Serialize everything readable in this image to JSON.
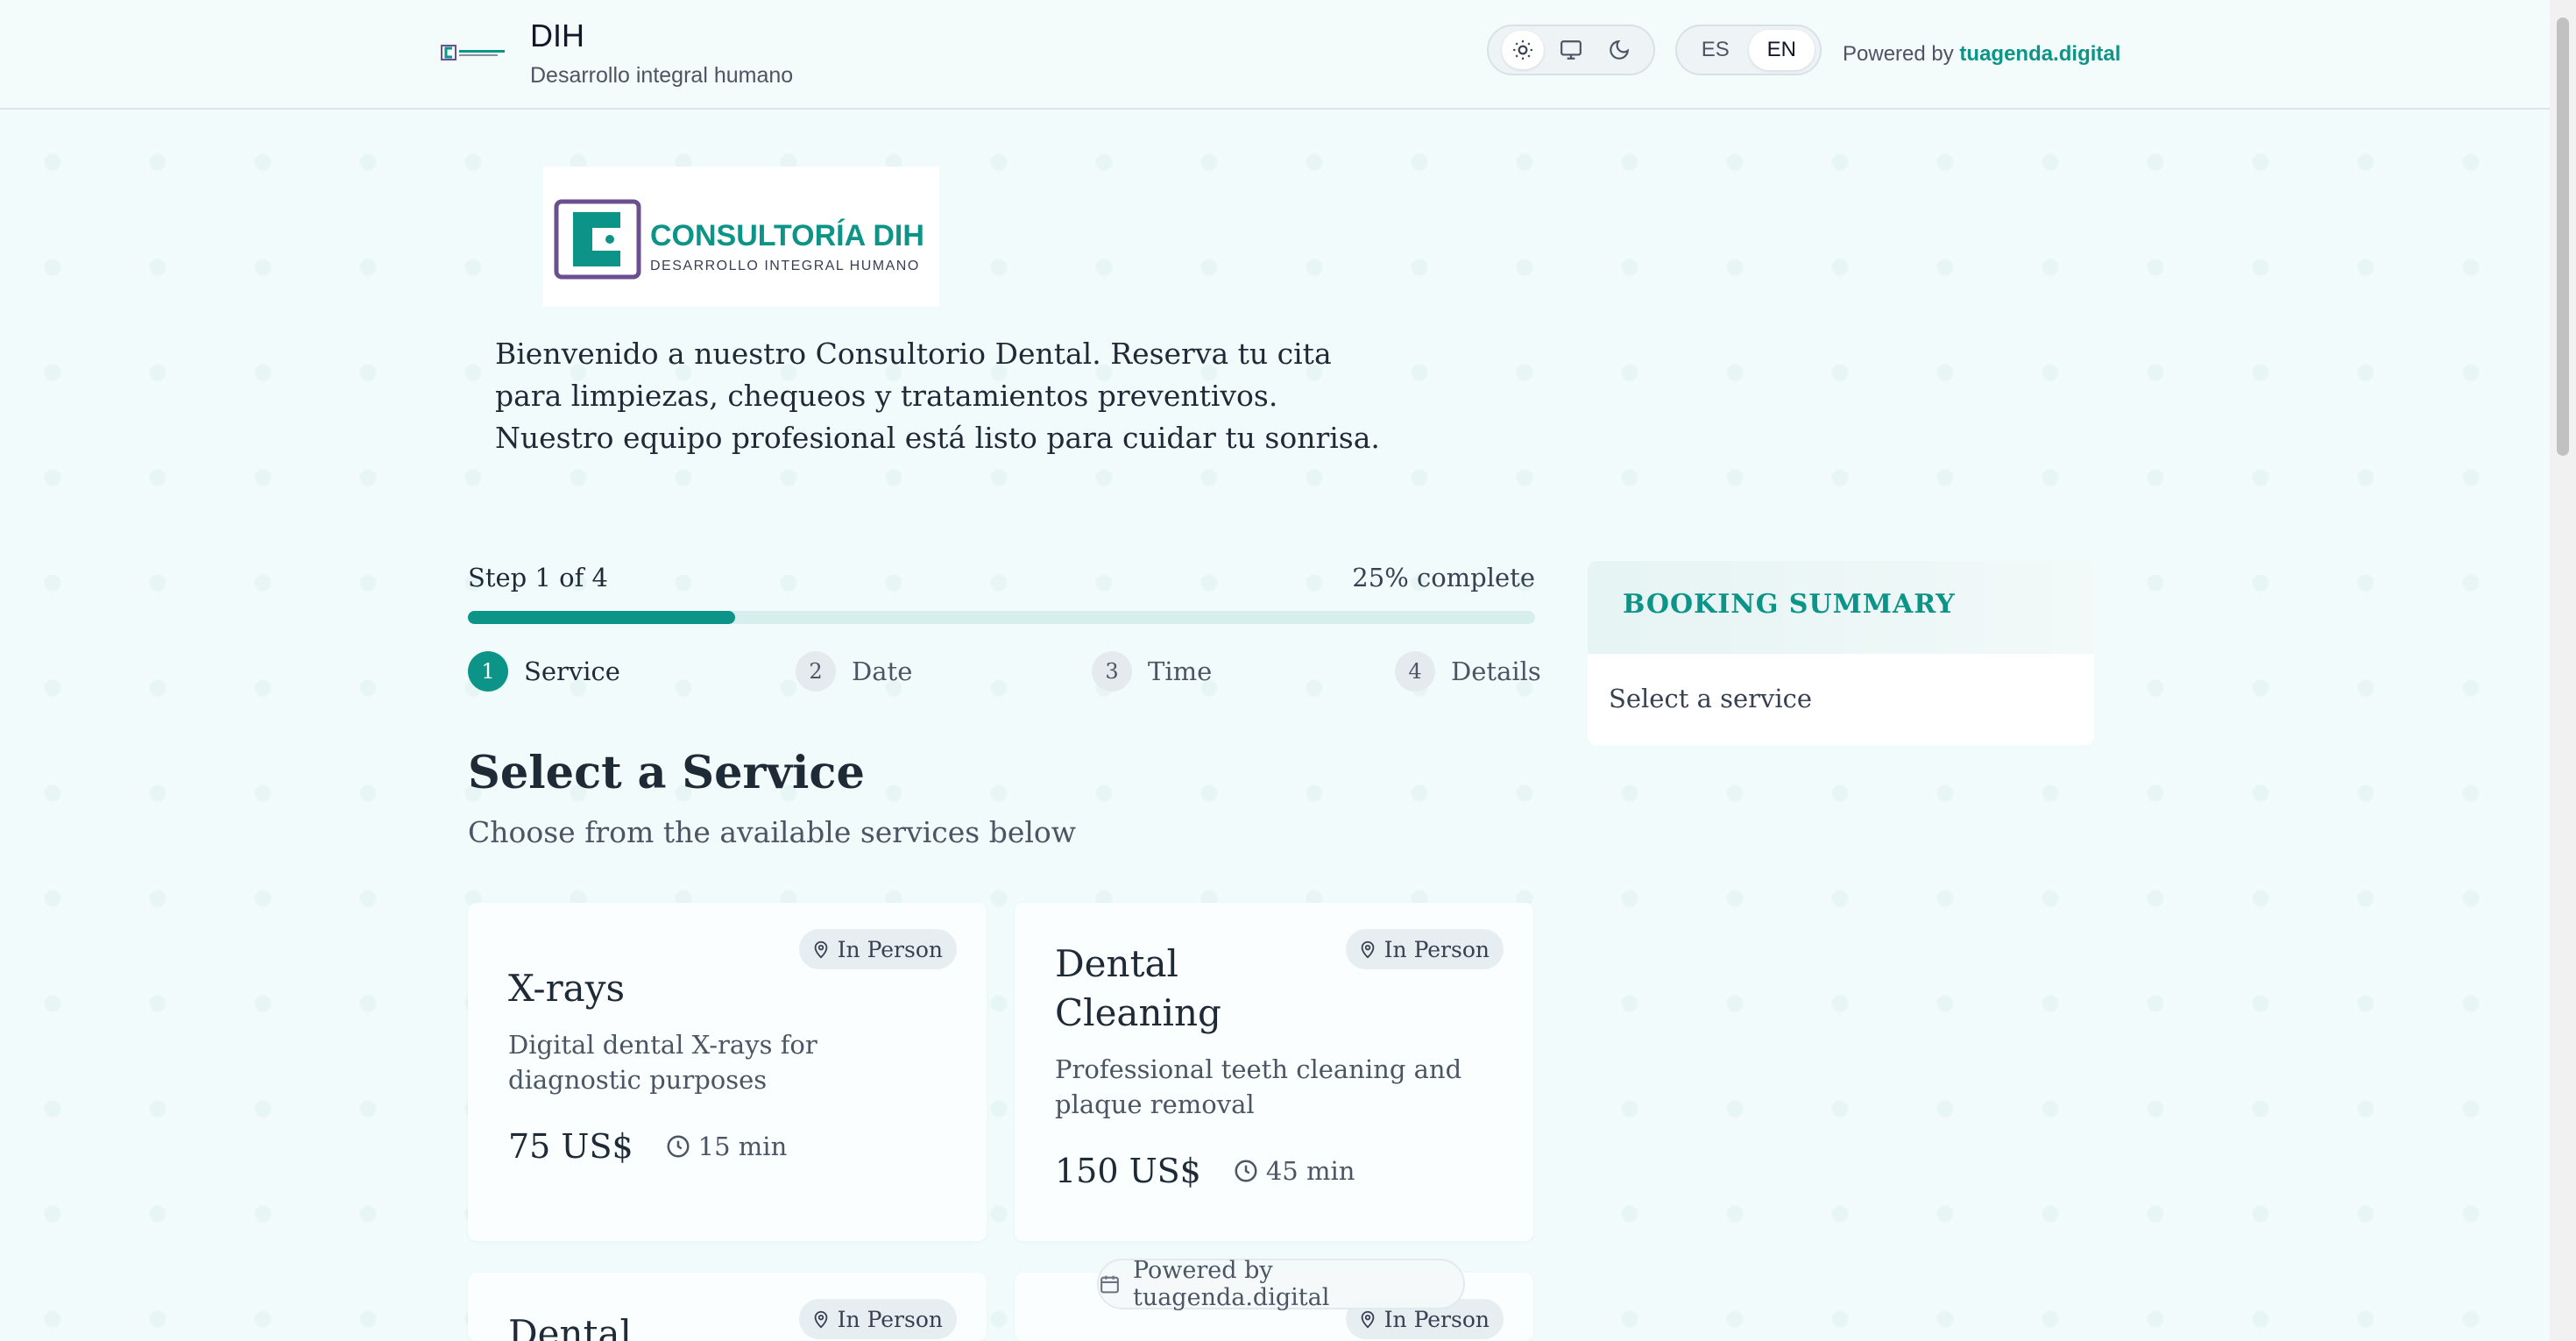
{
  "header": {
    "org_title": "DIH",
    "org_subtitle": "Desarrollo integral humano",
    "theme_options": [
      "light",
      "system",
      "dark"
    ],
    "lang": {
      "es": "ES",
      "en": "EN",
      "selected": "EN"
    },
    "powered_prefix": "Powered by",
    "powered_brand": "tuagenda.digital"
  },
  "logo": {
    "name": "CONSULTORÍA DIH",
    "tagline": "DESARROLLO INTEGRAL HUMANO"
  },
  "intro": "Bienvenido a nuestro Consultorio Dental. Reserva tu cita para limpiezas, chequeos y tratamientos preventivos. Nuestro equipo profesional está listo para cuidar tu sonrisa.",
  "progress": {
    "step_text": "Step 1 of 4",
    "percent_text": "25% complete",
    "fraction": 0.25
  },
  "steps": [
    {
      "num": "1",
      "label": "Service"
    },
    {
      "num": "2",
      "label": "Date"
    },
    {
      "num": "3",
      "label": "Time"
    },
    {
      "num": "4",
      "label": "Details"
    }
  ],
  "section": {
    "title": "Select a Service",
    "subtitle": "Choose from the available services below"
  },
  "services": [
    {
      "badge": "In Person",
      "title": "X-rays",
      "desc": "Digital dental X-rays for diagnostic purposes",
      "price": "75 US$",
      "duration": "15 min"
    },
    {
      "badge": "In Person",
      "title": "Dental Cleaning",
      "desc": "Professional teeth cleaning and plaque removal",
      "price": "150 US$",
      "duration": "45 min"
    },
    {
      "badge": "In Person",
      "title": "Dental"
    },
    {
      "badge": "In Person"
    }
  ],
  "summary": {
    "heading": "BOOKING SUMMARY",
    "placeholder": "Select a service"
  },
  "floating_badge": "Powered by tuagenda.digital",
  "colors": {
    "accent": "#0d9488",
    "logo_purple": "#6b4f8f",
    "background": "#f2fbfb"
  }
}
